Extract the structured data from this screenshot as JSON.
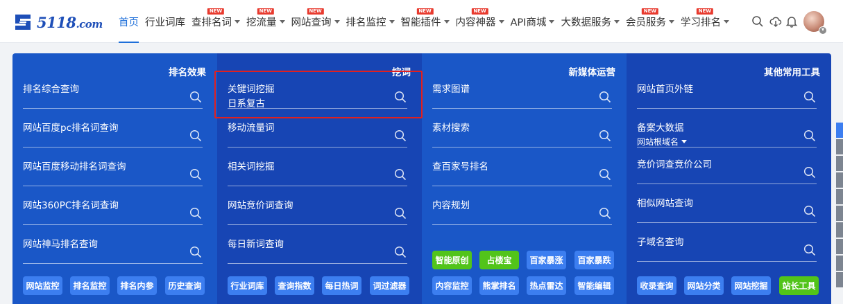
{
  "logo": {
    "text": "5118",
    "suffix": ".com"
  },
  "nav": [
    {
      "label": "首页",
      "active": true,
      "dropdown": false,
      "is_new": false
    },
    {
      "label": "行业词库",
      "active": false,
      "dropdown": false,
      "is_new": false
    },
    {
      "label": "查排名词",
      "active": false,
      "dropdown": true,
      "is_new": true
    },
    {
      "label": "挖流量",
      "active": false,
      "dropdown": true,
      "is_new": true
    },
    {
      "label": "网站查询",
      "active": false,
      "dropdown": true,
      "is_new": true
    },
    {
      "label": "排名监控",
      "active": false,
      "dropdown": true,
      "is_new": false
    },
    {
      "label": "智能插件",
      "active": false,
      "dropdown": true,
      "is_new": true
    },
    {
      "label": "内容神器",
      "active": false,
      "dropdown": true,
      "is_new": true
    },
    {
      "label": "API商城",
      "active": false,
      "dropdown": true,
      "is_new": false
    },
    {
      "label": "大数据服务",
      "active": false,
      "dropdown": true,
      "is_new": false
    },
    {
      "label": "会员服务",
      "active": false,
      "dropdown": true,
      "is_new": true
    },
    {
      "label": "学习排名",
      "active": false,
      "dropdown": true,
      "is_new": true
    }
  ],
  "new_badge": "NEW",
  "nav_icons": [
    "search-icon",
    "cloud-download-icon",
    "bell-icon"
  ],
  "columns": [
    {
      "title": "排名效果",
      "tools": [
        {
          "label": "排名综合查询"
        },
        {
          "label": "网站百度pc排名词查询"
        },
        {
          "label": "网站百度移动排名词查询"
        },
        {
          "label": "网站360PC排名词查询"
        },
        {
          "label": "网站神马排名查询"
        }
      ],
      "buttons": [
        {
          "label": "网站监控",
          "green": false
        },
        {
          "label": "排名监控",
          "green": false
        },
        {
          "label": "排名内参",
          "green": false
        },
        {
          "label": "历史查询",
          "green": false
        }
      ]
    },
    {
      "title": "挖词",
      "tools": [
        {
          "label": "关键词挖掘",
          "value": "日系复古"
        },
        {
          "label": "移动流量词"
        },
        {
          "label": "相关词挖掘"
        },
        {
          "label": "网站竞价词查询"
        },
        {
          "label": "每日新词查询"
        }
      ],
      "buttons": [
        {
          "label": "行业词库",
          "green": false
        },
        {
          "label": "查询指数",
          "green": false
        },
        {
          "label": "每日热词",
          "green": false
        },
        {
          "label": "词过滤器",
          "green": false
        }
      ]
    },
    {
      "title": "新媒体运营",
      "tools": [
        {
          "label": "需求图谱"
        },
        {
          "label": "素材搜索"
        },
        {
          "label": "查百家号排名"
        },
        {
          "label": "内容规划"
        }
      ],
      "buttons": [
        {
          "label": "智能原创",
          "green": true
        },
        {
          "label": "占楼宝",
          "green": true
        },
        {
          "label": "百家暴涨",
          "green": false
        },
        {
          "label": "百家暴跌",
          "green": false
        },
        {
          "label": "内容监控",
          "green": false
        },
        {
          "label": "熊掌排名",
          "green": false
        },
        {
          "label": "热点雷达",
          "green": false
        },
        {
          "label": "智能编辑",
          "green": false
        }
      ]
    },
    {
      "title": "其他常用工具",
      "tools": [
        {
          "label": "网站首页外链"
        },
        {
          "label": "备案大数据",
          "sub": "网站根域名"
        },
        {
          "label": "竞价词查竞价公司"
        },
        {
          "label": "相似网站查询"
        },
        {
          "label": "子域名查询"
        }
      ],
      "buttons": [
        {
          "label": "收录查询",
          "green": false
        },
        {
          "label": "网站分类",
          "green": false
        },
        {
          "label": "网站挖掘",
          "green": false
        },
        {
          "label": "站长工具",
          "green": true
        }
      ]
    }
  ],
  "colors": {
    "accent": "#1e6fd9",
    "panel_a": "#1a57c7",
    "panel_b": "#1745b4",
    "button": "#3c7ef0",
    "button_green": "#52c41a",
    "highlight": "#e02020",
    "new_badge": "#e83a2e"
  }
}
